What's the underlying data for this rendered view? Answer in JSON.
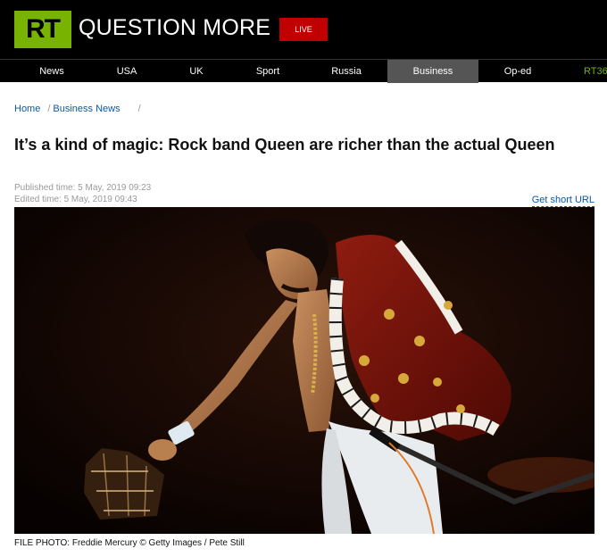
{
  "header": {
    "logo_text": "RT",
    "tagline": "QUESTION MORE",
    "live_label": "LIVE"
  },
  "nav": {
    "items": [
      "News",
      "USA",
      "UK",
      "Sport",
      "Russia",
      "Business",
      "Op-ed",
      "RT36"
    ],
    "active": "Business"
  },
  "breadcrumb": {
    "home": "Home",
    "section": "Business News"
  },
  "article": {
    "title": "It’s a kind of magic: Rock band Queen are richer than the actual Queen",
    "published": "Published time: 5 May, 2019 09:23",
    "edited": "Edited time: 5 May, 2019 09:43",
    "short_url_label": "Get short URL",
    "caption": "FILE PHOTO: Freddie Mercury © Getty Images / Pete Still"
  },
  "colors": {
    "brand_green": "#77b300",
    "live_red": "#c00000",
    "link_blue": "#0b57a6"
  }
}
